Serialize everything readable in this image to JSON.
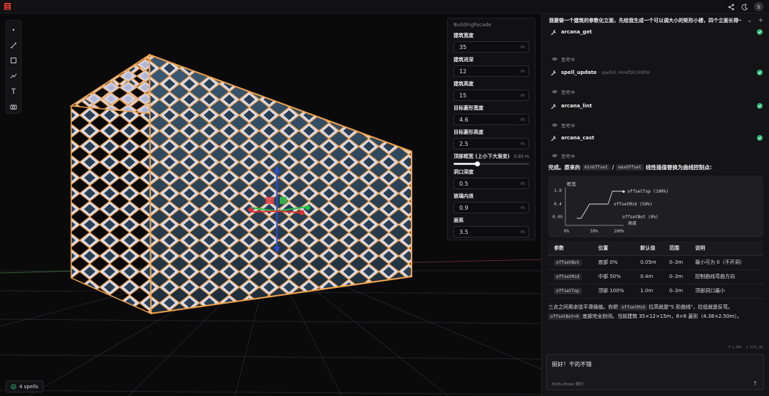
{
  "app": {
    "logo": "castle-logo-icon",
    "accent": "#e0443a"
  },
  "topbar": {
    "icons": [
      "share-icon",
      "moon-icon",
      "avatar"
    ],
    "avatar_letter": "S"
  },
  "toolbar": {
    "tools": [
      "point-icon",
      "line-icon",
      "rectangle-icon",
      "polyline-icon",
      "text-icon",
      "camera-icon"
    ]
  },
  "params": {
    "title": "BuildingFacade",
    "fields": [
      {
        "label": "建筑宽度",
        "value": "35",
        "unit": "m"
      },
      {
        "label": "建筑进深",
        "value": "12",
        "unit": "m"
      },
      {
        "label": "建筑高度",
        "value": "15",
        "unit": "m"
      },
      {
        "label": "目标菱形宽度",
        "value": "4.6",
        "unit": "m"
      },
      {
        "label": "目标菱形高度",
        "value": "2.5",
        "unit": "m"
      }
    ],
    "slider": {
      "label": "顶部框宽 (上小下大渐变)",
      "value": "0.93 m",
      "fraction": 0.31
    },
    "fields2": [
      {
        "label": "洞口深度",
        "value": "0.5",
        "unit": "m"
      },
      {
        "label": "玻璃内退",
        "value": "0.9",
        "unit": "m"
      },
      {
        "label": "层高",
        "value": "3.5",
        "unit": "m"
      }
    ]
  },
  "spells_badge": "4 spells",
  "chat": {
    "title": "我要做一个建筑的参数化立面，先给我生成一个可以调大小的矩形小楼，四个立面长得一…",
    "steps": [
      {
        "name": "arcana_get",
        "sub": ""
      },
      {
        "name": "spell_update",
        "sub": "· spellId: HmsfQh1XKPsl"
      },
      {
        "name": "arcana_lint",
        "sub": ""
      },
      {
        "name": "arcana_cast",
        "sub": ""
      }
    ],
    "thinking": "思考中",
    "message": {
      "prefix": "完成。原来的",
      "code1": "minOffset",
      "sep": "/",
      "code2": "maxOffset",
      "suffix": "线性插值替换为曲线控制点:"
    },
    "diagram": {
      "ylabel": "框宽",
      "yticks": [
        "1.0",
        "0.4",
        "0.05"
      ],
      "xticks": [
        "0%",
        "50%",
        "100%"
      ],
      "xlabel": "高度",
      "points": [
        "● offsetTop (100%)",
        "offsetMid (50%)",
        "offsetBot (0%)"
      ]
    },
    "table": {
      "headers": [
        "参数",
        "位置",
        "默认值",
        "范围",
        "说明"
      ],
      "rows": [
        [
          "offsetBot",
          "底部 0%",
          "0.05m",
          "0–3m",
          "最小可为 0（不开洞）"
        ],
        [
          "offsetMid",
          "中部 50%",
          "0.4m",
          "0–3m",
          "控制曲线弯曲方向"
        ],
        [
          "offsetTop",
          "顶部 100%",
          "1.0m",
          "0–3m",
          "顶部洞口最小"
        ]
      ]
    },
    "summary": {
      "p1": "三点之间用余弦平滑插值。你把",
      "code1": "offsetMid",
      "p2": "拉高就是\"S 形曲线\"，拉低就是反弯。",
      "code2": "offsetBot=0",
      "p3": "底部完全封闭。当前建筑 35×12×15m，8×6 菱形（4.38×2.50m）。"
    },
    "context": "T 1.9M · ↓ 151.3k",
    "input": {
      "text": "挺好！干的不错",
      "hint": "Shift+Enter 换行"
    }
  }
}
